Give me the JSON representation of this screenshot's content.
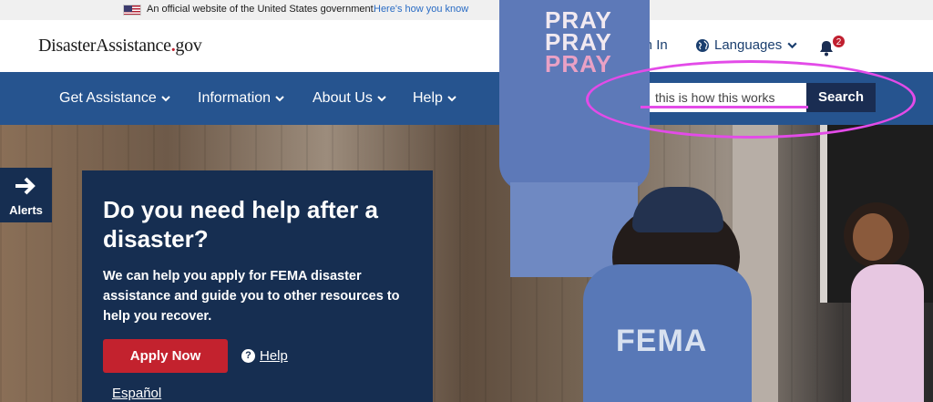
{
  "gov_banner": {
    "official_text": "An official website of the United States government.",
    "how_know_link": "Here's how you know"
  },
  "header": {
    "logo_main": "DisasterAssistance",
    "logo_dot": ".",
    "logo_suffix": "gov",
    "sign_in": "Sign In",
    "languages": "Languages",
    "notification_count": "2"
  },
  "nav": {
    "items": [
      {
        "label": "Get Assistance"
      },
      {
        "label": "Information"
      },
      {
        "label": "About Us"
      },
      {
        "label": "Help"
      }
    ],
    "search_value": "this is how this works",
    "search_button": "Search"
  },
  "alerts": {
    "label": "Alerts"
  },
  "hero": {
    "shirt_text": [
      "PRAY",
      "PRAY",
      "PRAY"
    ],
    "vest_text": "FEMA",
    "card": {
      "title": "Do you need help after a disaster?",
      "body": "We can help you apply for FEMA disaster assistance and guide you to other resources to help you recover.",
      "apply_button": "Apply Now",
      "help_link": "Help",
      "espanol_link": "Español"
    }
  },
  "colors": {
    "navbar": "#26548f",
    "card": "#162e51",
    "apply_button": "#c3222e",
    "annotation": "#e34be8"
  },
  "icons": {
    "flag": "us-flag-icon",
    "sign_in": "sign-in-icon",
    "languages": "globe-icon",
    "bell": "bell-icon",
    "chevron": "chevron-down-icon",
    "alerts": "arrow-right-icon",
    "help": "question-circle-icon"
  }
}
